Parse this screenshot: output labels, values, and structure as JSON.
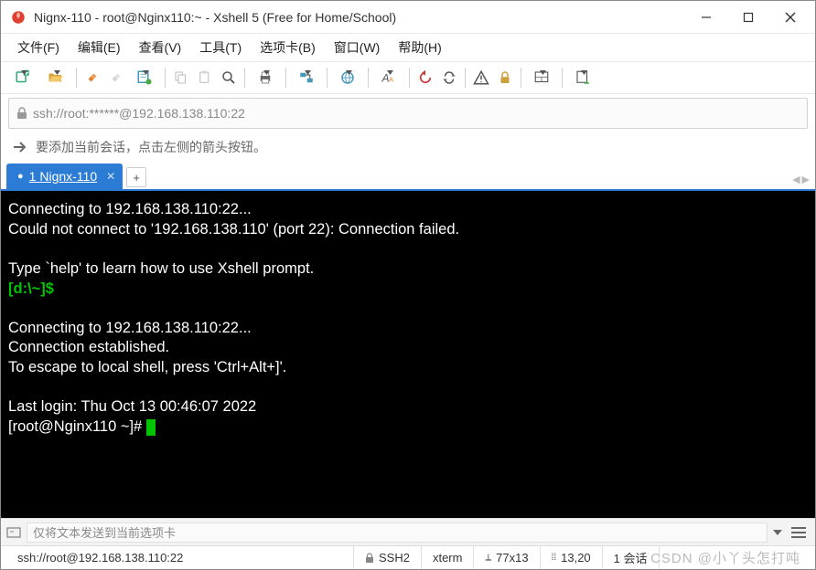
{
  "window": {
    "title": "Nignx-110 - root@Nginx110:~ - Xshell 5 (Free for Home/School)"
  },
  "menu": {
    "file": "文件(F)",
    "edit": "编辑(E)",
    "view": "查看(V)",
    "tools": "工具(T)",
    "tabs": "选项卡(B)",
    "window": "窗口(W)",
    "help": "帮助(H)"
  },
  "address": {
    "url": "ssh://root:******@192.168.138.110:22"
  },
  "hint": {
    "text": "要添加当前会话，点击左侧的箭头按钮。"
  },
  "tabs": {
    "active_index": "1",
    "active_label": "Nignx-110"
  },
  "terminal": {
    "line1": "Connecting to 192.168.138.110:22...",
    "line2": "Could not connect to '192.168.138.110' (port 22): Connection failed.",
    "line3": "",
    "line4": "Type `help' to learn how to use Xshell prompt.",
    "prompt1": "[d:\\~]$",
    "line5": "",
    "line6": "Connecting to 192.168.138.110:22...",
    "line7": "Connection established.",
    "line8": "To escape to local shell, press 'Ctrl+Alt+]'.",
    "line9": "",
    "line10": "Last login: Thu Oct 13 00:46:07 2022",
    "prompt2": "[root@Nginx110 ~]# "
  },
  "inputbar": {
    "placeholder": "仅将文本发送到当前选项卡"
  },
  "status": {
    "conn": "ssh://root@192.168.138.110:22",
    "proto": "SSH2",
    "term": "xterm",
    "size": "77x13",
    "pos": "13,20",
    "sessions": "1 会话"
  },
  "watermark": "CSDN @小丫头怎打吨"
}
